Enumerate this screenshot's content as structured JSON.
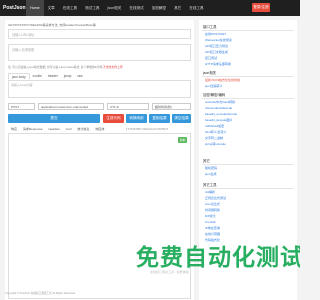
{
  "topbar": {
    "logo": "PostJson",
    "nav": [
      "Home",
      "文章",
      "在线工具",
      "测试工具",
      "json相关",
      "在线测试",
      "加密解密",
      "其它",
      "在线工具"
    ],
    "login": "登录/注册"
  },
  "form": {
    "hint": "GET/POST/PUT/DELETE等请求方法, 支持Header/Cookie/Body等",
    "url_placeholder": "请输入URL地址",
    "params_placeholder": "请输入请求参数",
    "note": "注: 可以直接输入json格式数据, 也可以输入key=value格式, 多个参数用&分隔.",
    "note_warn": "不支持文件上传",
    "tabs": [
      "json body",
      "cookie",
      "header",
      "jsonp",
      "raw"
    ],
    "body_placeholder": "请输入body内容",
    "method": "POST",
    "content_type": "application/x-www-form-urlencoded",
    "charset": "UTF-8",
    "timeout": "超时时间(秒)",
    "submit": "提交",
    "gen_code": "生成代码",
    "mapping": "转换映射",
    "copy": "复制结果",
    "clear": "清空结果"
  },
  "response": {
    "tabs": [
      "响应",
      "请求Response",
      "Headers",
      "Curl",
      "统计信息",
      "响应体"
    ],
    "stamp": "1774107907  2024-03-22 09:58:27",
    "copy": "复制"
  },
  "sidebar": {
    "sections": [
      {
        "title": "接口工具",
        "links": [
          "在线POST/GET",
          "Websocket在线测试",
          "API接口压力测试",
          "API接口文档生成",
          "接口调试",
          "HTTP请求头部转换"
        ]
      },
      {
        "title": "json相关",
        "links": [
          "最新JSON格式化在线校验",
          "json压缩转义"
        ],
        "highlight": [
          0
        ]
      },
      {
        "title": "加密/解密/编码",
        "links": [
          "unicode/中文/ascii转换",
          "urlencode/urldecode",
          "base64_encode/decode",
          "base64_decode图片",
          "md5/sha1加密",
          "html转义/反转义",
          "文字转二进制",
          "string转unicode"
        ]
      },
      {
        "title": "其它",
        "links": [
          "随机密码",
          "json生成"
        ]
      },
      {
        "title": "其它工具",
        "links": [
          "UA解析",
          "正则表达式测试",
          "cron表达式",
          "时间戳转换",
          "Diff对比",
          "Crontab",
          "IP地址查询",
          "在线计算器",
          "代码格式化"
        ]
      }
    ]
  },
  "ad": {
    "text": "免费自动化测试",
    "sub": "在线接口测试工具 - 免费体验"
  },
  "footer": "Copyright © PostJson 在线接口测试工具 All Rights Reserved"
}
